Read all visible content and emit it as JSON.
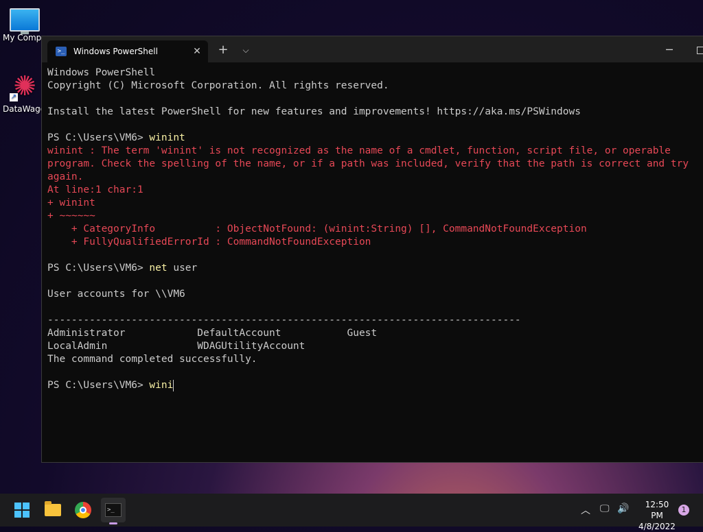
{
  "desktop": {
    "icons": [
      {
        "label": "My Comput"
      },
      {
        "label": "DataWagon"
      }
    ]
  },
  "window": {
    "tab_title": "Windows PowerShell",
    "tab_close": "✕",
    "new_tab": "+",
    "dropdown": "⌵",
    "minimize": "─"
  },
  "console": {
    "lines": [
      {
        "text": "Windows PowerShell",
        "style": "normal"
      },
      {
        "text": "Copyright (C) Microsoft Corporation. All rights reserved.",
        "style": "normal"
      },
      {
        "text": "",
        "style": "normal"
      },
      {
        "text": "Install the latest PowerShell for new features and improvements! https://aka.ms/PSWindows",
        "style": "normal"
      },
      {
        "text": "",
        "style": "normal"
      },
      {
        "prompt": "PS C:\\Users\\VM6> ",
        "cmd": "winint",
        "style": "prompt"
      },
      {
        "text": "winint : The term 'winint' is not recognized as the name of a cmdlet, function, script file, or operable",
        "style": "err"
      },
      {
        "text": "program. Check the spelling of the name, or if a path was included, verify that the path is correct and try",
        "style": "err"
      },
      {
        "text": "again.",
        "style": "err"
      },
      {
        "text": "At line:1 char:1",
        "style": "err"
      },
      {
        "text": "+ winint",
        "style": "err"
      },
      {
        "text": "+ ~~~~~~",
        "style": "err"
      },
      {
        "text": "    + CategoryInfo          : ObjectNotFound: (winint:String) [], CommandNotFoundException",
        "style": "err"
      },
      {
        "text": "    + FullyQualifiedErrorId : CommandNotFoundException",
        "style": "err"
      },
      {
        "text": "",
        "style": "normal"
      },
      {
        "prompt": "PS C:\\Users\\VM6> ",
        "cmd": "net user",
        "cmdParts": [
          "net",
          " user"
        ],
        "style": "prompt2"
      },
      {
        "text": "",
        "style": "normal"
      },
      {
        "text": "User accounts for \\\\VM6",
        "style": "normal"
      },
      {
        "text": "",
        "style": "normal"
      },
      {
        "text": "-------------------------------------------------------------------------------",
        "style": "normal"
      },
      {
        "text": "Administrator            DefaultAccount           Guest",
        "style": "normal"
      },
      {
        "text": "LocalAdmin               WDAGUtilityAccount",
        "style": "normal"
      },
      {
        "text": "The command completed successfully.",
        "style": "normal"
      },
      {
        "text": "",
        "style": "normal"
      },
      {
        "prompt": "PS C:\\Users\\VM6> ",
        "cmd": "wini",
        "style": "prompt-cursor"
      }
    ]
  },
  "taskbar": {
    "tray_chevron": "︿",
    "network_icon": "🖵",
    "volume_icon": "🔊",
    "time": "12:50 PM",
    "date": "4/8/2022",
    "notification_count": "1",
    "start_color": "#4cc2ff"
  },
  "colors": {
    "console_bg": "#0c0c0c",
    "console_text": "#cccccc",
    "error_text": "#e74856",
    "command_text": "#f9f1a5",
    "titlebar_bg": "#202020",
    "taskbar_bg": "#1c1c1e"
  }
}
